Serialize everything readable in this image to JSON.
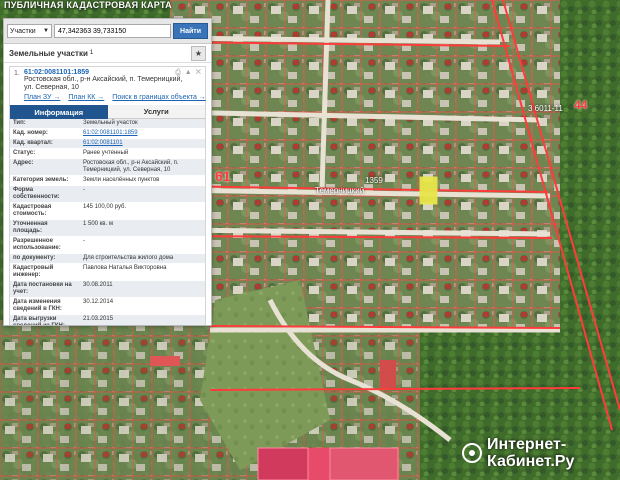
{
  "map": {
    "title": "ПУБЛИЧНАЯ КАДАСТРОВАЯ КАРТА",
    "labels": {
      "block_61": "61",
      "block_44": "44",
      "block_code": "3 6011-11",
      "street": "Темерницкий",
      "parcel_1359": "1359"
    },
    "colors": {
      "boundary": "#ff4a4a",
      "highlight": "#e8e64a",
      "vegetation": "#3f6b2b"
    }
  },
  "search": {
    "type_label": "Участки",
    "value": "47,342363 39,733150",
    "find_label": "Найти"
  },
  "results": {
    "title": "Земельные участки",
    "count": "1"
  },
  "result": {
    "index": "1.",
    "cad_number": "61:02:0081101:1859",
    "address_line1": "Ростовская обл., р-н Аксайский, п. Темерницкий,",
    "address_line2": "ул. Северная, 10",
    "link_zu": "План ЗУ →",
    "link_kk": "План КК →",
    "link_border": "Поиск в границах объекта →"
  },
  "tabs": {
    "info": "Информация",
    "services": "Услуги"
  },
  "info": {
    "type": {
      "label": "Тип:",
      "value": "Земельный участок"
    },
    "cad_no": {
      "label": "Кад. номер:",
      "value": "61:02:0081101:1859"
    },
    "cad_block": {
      "label": "Кад. квартал:",
      "value": "61:02:0081101"
    },
    "status": {
      "label": "Статус:",
      "value": "Ранее учтенный"
    },
    "address": {
      "label": "Адрес:",
      "value": "Ростовская обл., р-н Аксайский, п. Темерницкий, ул. Северная, 10"
    },
    "land_cat": {
      "label": "Категория земель:",
      "value": "Земли населённых пунктов"
    },
    "ownership": {
      "label": "Форма собственности:",
      "value": "-"
    },
    "cad_cost": {
      "label": "Кадастровая стоимость:",
      "value": "145 100,00 руб."
    },
    "area": {
      "label": "Уточненная площадь:",
      "value": "1 500 кв. м"
    },
    "permitted": {
      "label": "Разрешенное использование:",
      "value": "-"
    },
    "by_doc": {
      "label": "по документу:",
      "value": "Для строительства жилого дома"
    },
    "engineer": {
      "label": "Кадастровый инженер:",
      "value": "Павлова Наталья Викторовна"
    },
    "reg_date": {
      "label": "Дата постановки на учет:",
      "value": "30.08.2011"
    },
    "change_date": {
      "label": "Дата изменения сведений в ГКН:",
      "value": "30.12.2014"
    },
    "extract_date": {
      "label": "Дата выгрузки сведений из ГКН:",
      "value": "21.03.2015"
    }
  },
  "watermark": {
    "line1": "Интернет-",
    "line2": "Кабинет.Ру"
  }
}
